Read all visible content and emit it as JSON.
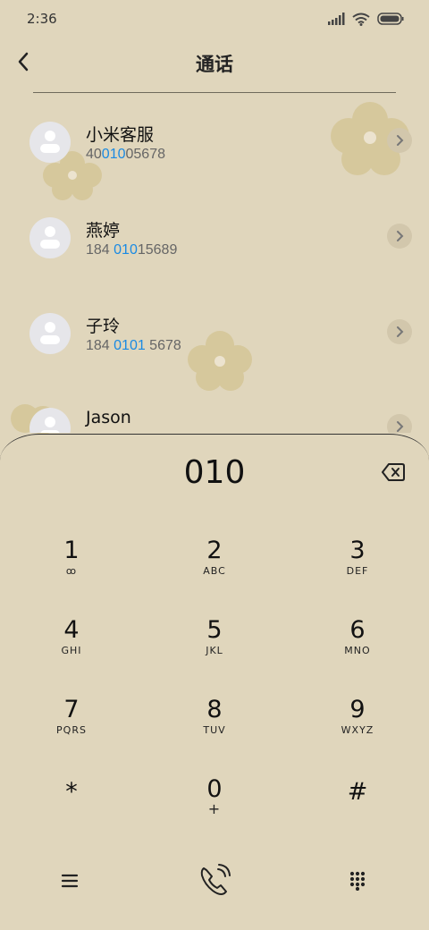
{
  "status_bar": {
    "time": "2:36",
    "icons": [
      "signal-icon",
      "wifi-icon",
      "battery-icon"
    ]
  },
  "header": {
    "title": "通话",
    "back_icon": "chevron-left-icon"
  },
  "contacts": [
    {
      "name": "小米客服",
      "number_pre": "40",
      "number_match": "010",
      "number_post": "05678"
    },
    {
      "name": "燕婷",
      "number_pre": "184 ",
      "number_match": "010",
      "number_post": "15689"
    },
    {
      "name": "子玲",
      "number_pre": "184 ",
      "number_match": "0101",
      "number_post": " 5678"
    },
    {
      "name": "Jason",
      "number_pre": "",
      "number_match": "",
      "number_post": ""
    }
  ],
  "dialpad": {
    "input": "010",
    "keys": [
      {
        "digit": "1",
        "letters": "ꝏ"
      },
      {
        "digit": "2",
        "letters": "ABC"
      },
      {
        "digit": "3",
        "letters": "DEF"
      },
      {
        "digit": "4",
        "letters": "GHI"
      },
      {
        "digit": "5",
        "letters": "JKL"
      },
      {
        "digit": "6",
        "letters": "MNO"
      },
      {
        "digit": "7",
        "letters": "PQRS"
      },
      {
        "digit": "8",
        "letters": "TUV"
      },
      {
        "digit": "9",
        "letters": "WXYZ"
      },
      {
        "digit": "*",
        "letters": ""
      },
      {
        "digit": "0",
        "letters": "+"
      },
      {
        "digit": "#",
        "letters": ""
      }
    ]
  },
  "bottom_bar": {
    "icons": [
      "menu-icon",
      "call-icon",
      "dialpad-icon"
    ]
  },
  "colors": {
    "background": "#e0d6bc",
    "highlight": "#1a8ae3",
    "flower": "#d6c89c"
  }
}
